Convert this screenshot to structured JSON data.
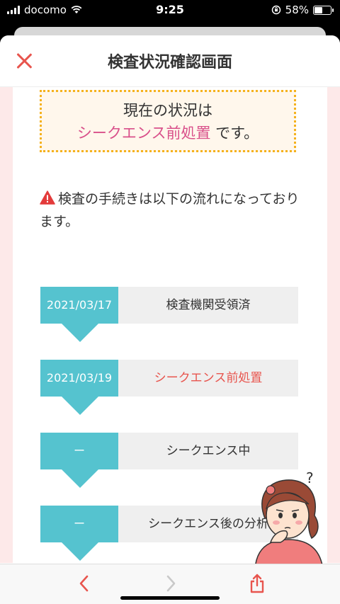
{
  "status_bar": {
    "carrier": "docomo",
    "time": "9:25",
    "battery": "58%",
    "battery_level": 0.58
  },
  "header": {
    "title": "検査状況確認画面",
    "close_icon": "close-icon"
  },
  "status_box": {
    "line1": "現在の状況は",
    "status": "シークエンス前処置",
    "suffix": " です。"
  },
  "notice": {
    "icon": "warning-icon",
    "text": "検査の手続きは以下の流れになっております。"
  },
  "steps": [
    {
      "date": "2021/03/17",
      "label": "検査機関受領済",
      "active": false
    },
    {
      "date": "2021/03/19",
      "label": "シークエンス前処置",
      "active": true
    },
    {
      "date": "ー",
      "label": "シークエンス中",
      "active": false
    },
    {
      "date": "ー",
      "label": "シークエンス後の分析",
      "active": false
    }
  ],
  "colors": {
    "accent": "#55c3cf",
    "close_red": "#e8554e",
    "status_pink": "#d9508a",
    "dotted_border": "#f5b21e",
    "side_bg": "#fde9e9"
  },
  "toolbar": {
    "back_icon": "chevron-left-icon",
    "forward_icon": "chevron-right-icon",
    "share_icon": "share-icon"
  }
}
